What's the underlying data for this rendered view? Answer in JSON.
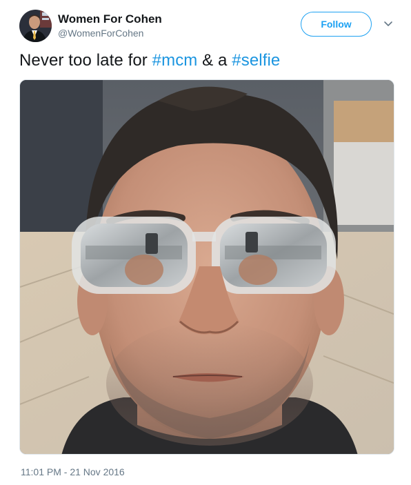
{
  "user": {
    "display_name": "Women For Cohen",
    "handle": "@WomenForCohen"
  },
  "actions": {
    "follow_label": "Follow",
    "more_icon": "chevron-down-icon"
  },
  "tweet": {
    "text_before": "Never too late for ",
    "hashtag_1": "#mcm",
    "text_middle": " & a ",
    "hashtag_2": "#selfie"
  },
  "media": {
    "icon": "selfie-photo"
  },
  "meta": {
    "timestamp": "11:01 PM - 21 Nov 2016"
  },
  "colors": {
    "accent": "#1da1f2",
    "hashtag": "#1b95e0",
    "text": "#14171a",
    "muted": "#657786"
  }
}
